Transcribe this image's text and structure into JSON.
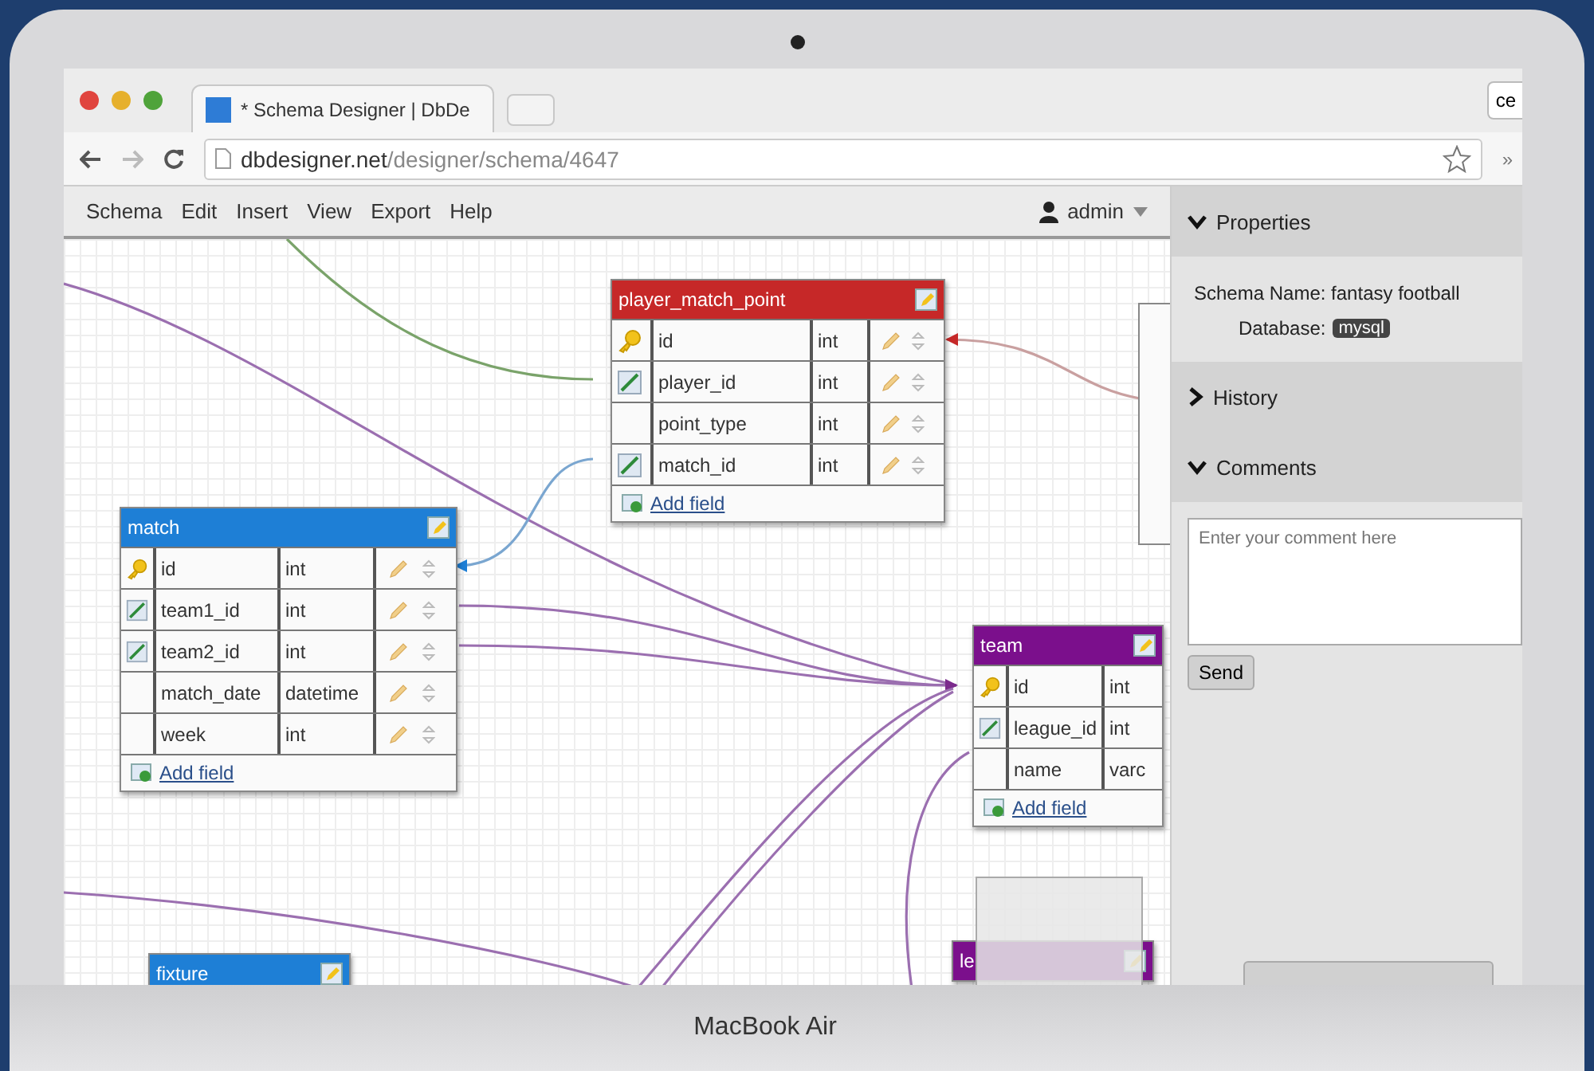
{
  "device_label": "MacBook Air",
  "browser": {
    "tab_title": "* Schema Designer | DbDe",
    "url_host": "dbdesigner.net",
    "url_path": "/designer/schema/4647",
    "extension_label": "ce",
    "more": "»"
  },
  "menu": [
    "Schema",
    "Edit",
    "Insert",
    "View",
    "Export",
    "Help"
  ],
  "user": "admin",
  "tables": [
    {
      "name": "player_match_point",
      "color": "#c62828",
      "add_label": "Add field",
      "fields": [
        {
          "kind": "pk",
          "name": "id",
          "type": "int"
        },
        {
          "kind": "fk",
          "name": "player_id",
          "type": "int"
        },
        {
          "kind": "plain",
          "name": "point_type",
          "type": "int"
        },
        {
          "kind": "fk",
          "name": "match_id",
          "type": "int"
        }
      ]
    },
    {
      "name": "match",
      "color": "#1e7fd6",
      "add_label": "Add field",
      "fields": [
        {
          "kind": "pk",
          "name": "id",
          "type": "int"
        },
        {
          "kind": "fk",
          "name": "team1_id",
          "type": "int"
        },
        {
          "kind": "fk",
          "name": "team2_id",
          "type": "int"
        },
        {
          "kind": "plain",
          "name": "match_date",
          "type": "datetime"
        },
        {
          "kind": "plain",
          "name": "week",
          "type": "int"
        }
      ]
    },
    {
      "name": "team",
      "color": "#7b0f8c",
      "add_label": "Add field",
      "fields": [
        {
          "kind": "pk",
          "name": "id",
          "type": "int"
        },
        {
          "kind": "fk",
          "name": "league_id",
          "type": "int"
        },
        {
          "kind": "plain",
          "name": "name",
          "type": "varc"
        }
      ]
    },
    {
      "name": "le",
      "color": "#7b0f8c"
    },
    {
      "name": "fixture",
      "color": "#1e7fd6"
    }
  ],
  "panel": {
    "sections": [
      {
        "title": "Properties",
        "expanded": true
      },
      {
        "title": "History",
        "expanded": false
      },
      {
        "title": "Comments",
        "expanded": true
      }
    ],
    "schema_name_label": "Schema Name:",
    "schema_name": "fantasy football",
    "database_label": "Database:",
    "database": "mysql",
    "comment_placeholder": "Enter your comment here",
    "send": "Send"
  }
}
